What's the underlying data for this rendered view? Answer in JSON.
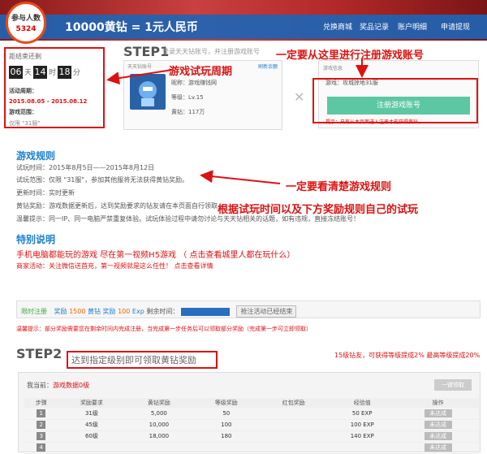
{
  "header": {
    "participants_label": "参与人数",
    "participants_count": "5324",
    "promo": "10000黄钻 = 1元人民币",
    "menu": [
      "兑换商城",
      "奖品记录",
      "账户明细",
      "申请提现"
    ]
  },
  "timer": {
    "label": "距结束还剩",
    "days": "06",
    "day_unit": "天",
    "hours": "14",
    "hour_unit": "时",
    "minutes": "18",
    "minute_unit": "分",
    "period_label": "活动周期：",
    "period": "2015.08.05 - 2015.08.12",
    "scope_label": "游戏范围：",
    "scope": "仅限 \"31服\""
  },
  "step1": {
    "title": "STEP1",
    "hint": "登录天天钻账号，并注册游戏账号",
    "left_panel_title": "天天钻账号",
    "left_panel_link": "刷新余额",
    "nickname": "昵称：游戏赚钱网",
    "level": "等级：Lv.15",
    "diamonds": "黄钻：117万",
    "right_panel_title": "游戏信息",
    "game_server": "游戏：攻城掠地31服",
    "register_button": "注册游戏账号",
    "notice": "提示：只有从本页面进入注册才能获得黄钻。"
  },
  "annotations": {
    "register_here": "一定要从这里进行注册游戏账号",
    "trial_period": "游戏试玩周期",
    "read_rules": "一定要看清楚游戏规则",
    "plan_trial": "根据试玩时间以及下方奖励规则自己的试玩"
  },
  "rules": {
    "title": "游戏规则",
    "lines": [
      "试玩时间：2015年8月5日——2015年8月12日",
      "试玩范围：仅限 \"31服\"，参加其他服将无法获得黄钻奖励。",
      "更新时间：实时更新",
      "黄钻奖励：游戏数据更新后，达到奖励要求的钻友请在本页面自行领取。",
      "温馨提示：同一IP、同一电脑严禁重复体验。试玩体验过程中请勿讨论与天天钻相关的话题，如有违规，直接冻结账号！"
    ]
  },
  "special": {
    "title": "特别说明",
    "line1": "手机电脑都能玩的游戏  尽在第一视频H5游戏 （  点击查看城里人都在玩什么）",
    "line2": "商家活动：关注微信送首充，第一视频就是这么任性！  点击查看详情"
  },
  "limited": {
    "label": "限时注册",
    "reward_label": "奖励",
    "reward_diamonds": "1500",
    "diamond_unit": "黄钻",
    "reward_exp_label": "奖励",
    "reward_exp": "100",
    "exp_unit": "Exp",
    "remaining_label": "剩余时间：",
    "button": "抢注活动已经结束"
  },
  "warning": "温馨提示：部分奖励需要您在剩余时间内完成注册，当完成第一步任务后可以领取部分奖励（完成第一步可立即领取）",
  "step2": {
    "title": "STEP2",
    "subtitle": "达到指定级别即可领取黄钻奖励",
    "promo_line": "15级钻友，可获得等级提成2%  最高等级提成20%",
    "current_label": "我当前：",
    "current_value": "游戏数据0级",
    "receive_button": "一键领取",
    "headers": [
      "步骤",
      "奖励要求",
      "黄钻奖励",
      "等级奖励",
      "红包奖励",
      "经验值",
      "操作"
    ],
    "rows": [
      [
        "1",
        "31级",
        "5,000",
        "50",
        "",
        "50 EXP",
        "未达成"
      ],
      [
        "2",
        "45级",
        "10,000",
        "100",
        "",
        "100 EXP",
        "未达成"
      ],
      [
        "3",
        "60级",
        "18,000",
        "180",
        "",
        "140 EXP",
        "未达成"
      ],
      [
        "4",
        "",
        "",
        "",
        "",
        "",
        "未达成"
      ]
    ]
  }
}
